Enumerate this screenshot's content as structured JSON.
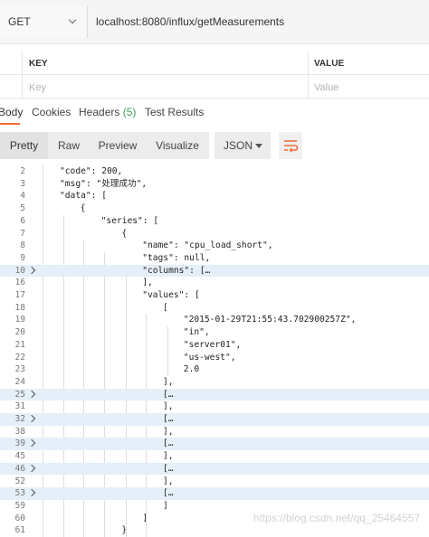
{
  "request": {
    "method": "GET",
    "url": "localhost:8080/influx/getMeasurements"
  },
  "params_table": {
    "headers": [
      "KEY",
      "VALUE"
    ],
    "placeholders": [
      "Key",
      "Value"
    ]
  },
  "response_tabs": [
    {
      "label": "Body",
      "count": "",
      "active": true
    },
    {
      "label": "Cookies",
      "count": "",
      "active": false
    },
    {
      "label": "Headers",
      "count": "(5)",
      "active": false
    },
    {
      "label": "Test Results",
      "count": "",
      "active": false
    }
  ],
  "toolbar": {
    "views": [
      "Pretty",
      "Raw",
      "Preview",
      "Visualize"
    ],
    "active_view": "Pretty",
    "format": "JSON"
  },
  "code_lines": [
    {
      "num": "2",
      "text": "\"code\": 200,",
      "indent": 0,
      "fold": false
    },
    {
      "num": "3",
      "text": "\"msg\": \"处理成功\",",
      "indent": 0,
      "fold": false
    },
    {
      "num": "4",
      "text": "\"data\": [",
      "indent": 0,
      "fold": false
    },
    {
      "num": "5",
      "text": "{",
      "indent": 1,
      "fold": false
    },
    {
      "num": "6",
      "text": "\"series\": [",
      "indent": 2,
      "fold": false
    },
    {
      "num": "7",
      "text": "{",
      "indent": 3,
      "fold": false
    },
    {
      "num": "8",
      "text": "\"name\": \"cpu_load_short\",",
      "indent": 4,
      "fold": false
    },
    {
      "num": "9",
      "text": "\"tags\": null,",
      "indent": 4,
      "fold": false
    },
    {
      "num": "10",
      "text": "\"columns\": […",
      "indent": 4,
      "fold": true
    },
    {
      "num": "16",
      "text": "],",
      "indent": 4,
      "fold": false
    },
    {
      "num": "17",
      "text": "\"values\": [",
      "indent": 4,
      "fold": false
    },
    {
      "num": "18",
      "text": "[",
      "indent": 5,
      "fold": false
    },
    {
      "num": "19",
      "text": "\"2015-01-29T21:55:43.702900257Z\",",
      "indent": 6,
      "fold": false
    },
    {
      "num": "20",
      "text": "\"in\",",
      "indent": 6,
      "fold": false
    },
    {
      "num": "21",
      "text": "\"server01\",",
      "indent": 6,
      "fold": false
    },
    {
      "num": "22",
      "text": "\"us-west\",",
      "indent": 6,
      "fold": false
    },
    {
      "num": "23",
      "text": "2.0",
      "indent": 6,
      "fold": false
    },
    {
      "num": "24",
      "text": "],",
      "indent": 5,
      "fold": false
    },
    {
      "num": "25",
      "text": "[…",
      "indent": 5,
      "fold": true
    },
    {
      "num": "31",
      "text": "],",
      "indent": 5,
      "fold": false
    },
    {
      "num": "32",
      "text": "[…",
      "indent": 5,
      "fold": true
    },
    {
      "num": "38",
      "text": "],",
      "indent": 5,
      "fold": false
    },
    {
      "num": "39",
      "text": "[…",
      "indent": 5,
      "fold": true
    },
    {
      "num": "45",
      "text": "],",
      "indent": 5,
      "fold": false
    },
    {
      "num": "46",
      "text": "[…",
      "indent": 5,
      "fold": true
    },
    {
      "num": "52",
      "text": "],",
      "indent": 5,
      "fold": false
    },
    {
      "num": "53",
      "text": "[…",
      "indent": 5,
      "fold": true
    },
    {
      "num": "59",
      "text": "]",
      "indent": 5,
      "fold": false
    },
    {
      "num": "60",
      "text": "]",
      "indent": 4,
      "fold": false
    },
    {
      "num": "61",
      "text": "}",
      "indent": 3,
      "fold": false
    }
  ],
  "watermark": "https://blog.csdn.net/qq_25464557",
  "colors": {
    "accent": "#f26b3a",
    "highlight": "#e4eff9",
    "count_green": "#3ca05a"
  },
  "icons": {
    "method_dropdown": "chevron-down-icon",
    "format_dropdown": "caret-down-icon",
    "wrap": "wrap-lines-icon",
    "fold": "chevron-right-icon"
  }
}
